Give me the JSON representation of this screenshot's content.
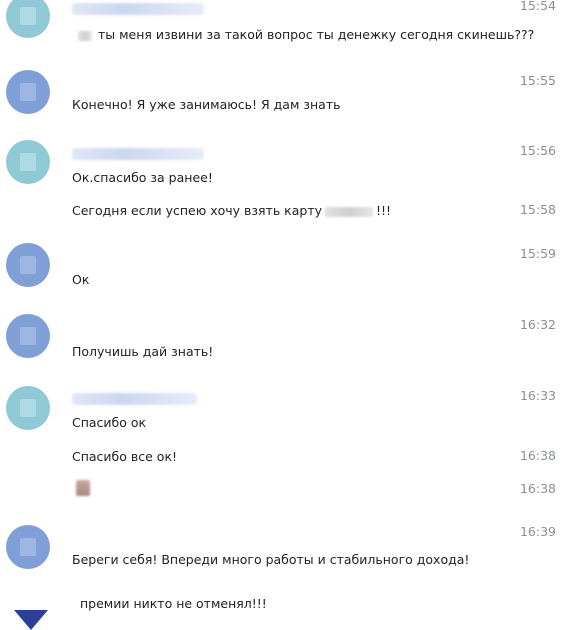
{
  "messages": [
    {
      "text": "ты меня извини за такой вопрос ты денежку сегодня скинешь???",
      "time": "15:54"
    },
    {
      "text": "Конечно! Я уже занимаюсь! Я дам знать",
      "time": "15:55"
    },
    {
      "text": "Ок.спасибо за ранее!",
      "time": "15:56"
    },
    {
      "text": "Сегодня если успею хочу взять карту",
      "suffix": "!!!",
      "time": "15:58"
    },
    {
      "text": "Ок",
      "time": "15:59"
    },
    {
      "text": "Получишь дай знать!",
      "time": "16:32"
    },
    {
      "text": "Спасибо ок",
      "time": "16:33"
    },
    {
      "text": "Спасибо все ок!",
      "time": "16:38"
    },
    {
      "text": "",
      "time": "16:38"
    },
    {
      "text": "Береги себя! Впереди много работы и стабильного дохода!",
      "time": "16:39"
    },
    {
      "text": "премии никто не отменял!!!",
      "time": ""
    }
  ],
  "colors": {
    "avatar_teal": "#8fc9d6",
    "avatar_blue": "#7f9fd6",
    "time_text": "#8a8f96",
    "flag_blue": "#2c3f97"
  }
}
